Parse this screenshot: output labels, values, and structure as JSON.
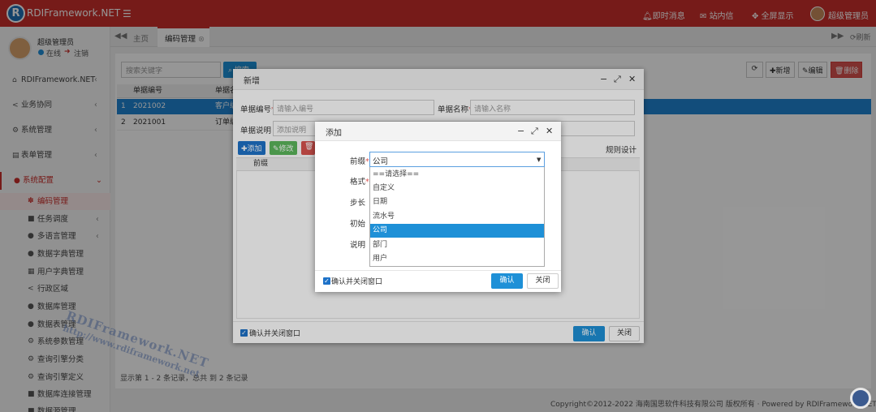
{
  "topbar": {
    "brand": "RDIFramework.NET",
    "logo_letter": "R",
    "messages": "即时消息",
    "mail": "站内信",
    "fullscreen": "全屏显示",
    "user": "超级管理员"
  },
  "sidebar": {
    "username": "超级管理员",
    "status": "在线",
    "logout": "注销",
    "items": [
      {
        "label": "RDIFramework.NET",
        "icon": "home-icon"
      },
      {
        "label": "业务协同",
        "icon": "share-icon"
      },
      {
        "label": "系统管理",
        "icon": "gears-icon"
      },
      {
        "label": "表单管理",
        "icon": "list-icon"
      },
      {
        "label": "系统配置",
        "icon": "settings-icon"
      }
    ],
    "subitems": [
      {
        "label": "编码管理",
        "active": true
      },
      {
        "label": "任务调度"
      },
      {
        "label": "多语言管理"
      },
      {
        "label": "数据字典管理"
      },
      {
        "label": "用户字典管理"
      },
      {
        "label": "行政区域"
      },
      {
        "label": "数据库管理"
      },
      {
        "label": "数据表管理"
      },
      {
        "label": "系统参数管理"
      },
      {
        "label": "查询引擎分类"
      },
      {
        "label": "查询引擎定义"
      },
      {
        "label": "数据库连接管理"
      },
      {
        "label": "数据源管理"
      }
    ]
  },
  "tabs": {
    "home": "主页",
    "current": "编码管理",
    "refresh": "刷新"
  },
  "main": {
    "search_placeholder": "搜索关键字",
    "search_button": "搜索",
    "toolbar": {
      "add": "新增",
      "edit": "编辑",
      "delete": "删除"
    },
    "columns": [
      "单据编号",
      "单据名称"
    ],
    "rows": [
      {
        "no": "1",
        "code": "2021002",
        "name": "客户编"
      },
      {
        "no": "2",
        "code": "2021001",
        "name": "订单编"
      }
    ],
    "pager": "显示第 1 - 2 条记录，总共 到 2 条记录"
  },
  "footer": {
    "copyright": "Copyright©2012-2022 海南国思软件科技有限公司 版权所有 · Powered by RDIFramework.NET V5.1"
  },
  "dialog_add": {
    "title": "新增",
    "label_code": "单据编号",
    "placeholder_code": "请输入编号",
    "label_name": "单据名称",
    "placeholder_name": "请输入名称",
    "label_desc": "单据说明",
    "placeholder_desc": "添加说明",
    "sub_add": "添加",
    "sub_edit": "修改",
    "rules_label": "规则设计",
    "sub_col_prefix": "前缀",
    "confirm_close": "确认并关闭窗口",
    "ok": "确认",
    "close": "关闭"
  },
  "dialog_rule": {
    "title": "添加",
    "label_prefix": "前缀",
    "label_format": "格式",
    "label_step": "步长",
    "label_initial": "初始",
    "label_desc": "说明",
    "selected": "公司",
    "options": [
      "==请选择==",
      "自定义",
      "日期",
      "流水号",
      "公司",
      "部门",
      "用户"
    ],
    "selected_index": 4,
    "confirm_close": "确认并关闭窗口",
    "ok": "确认",
    "close": "关闭"
  },
  "watermark": {
    "line1": "RDIFramework.NET",
    "line2": "http://www.rdiframework.net"
  },
  "colors": {
    "accent": "#c9302c",
    "primary": "#1e90d7"
  }
}
